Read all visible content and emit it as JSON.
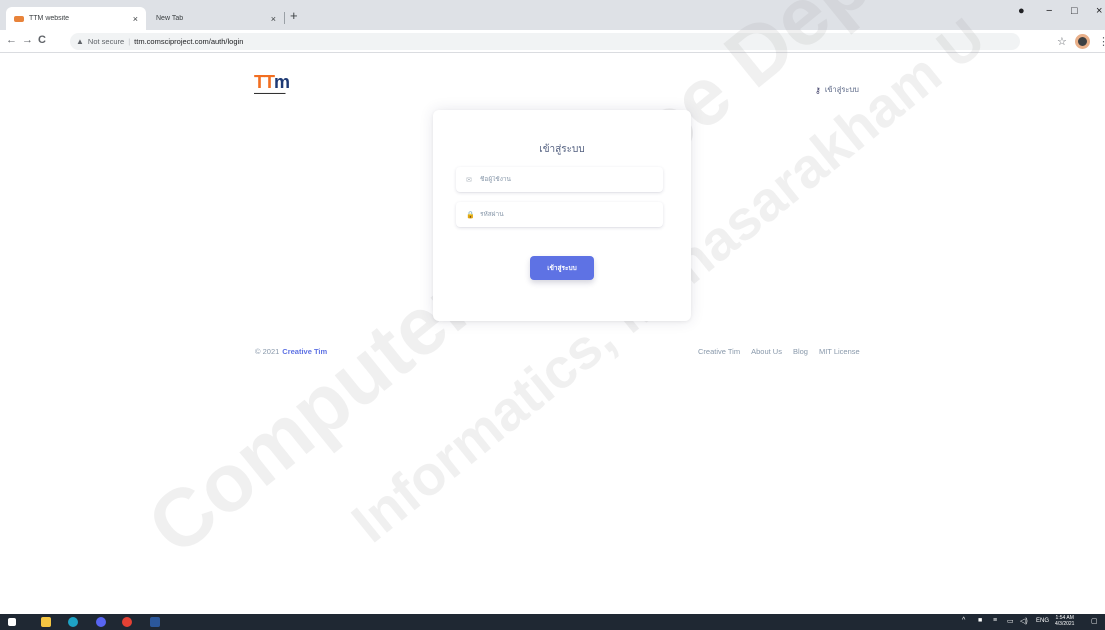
{
  "browser": {
    "tabs": [
      {
        "title": "TTM website",
        "close": "×"
      },
      {
        "title": "New Tab",
        "close": "×"
      }
    ],
    "new_tab": "+",
    "nav": {
      "back": "←",
      "forward": "→",
      "reload": "C"
    },
    "security_label": "Not secure",
    "url": "ttm.comsciproject.com/auth/login",
    "star": "☆",
    "menu": "⋮",
    "window": {
      "minimize": "−",
      "maximize": "□",
      "close": "×"
    }
  },
  "header": {
    "logo": {
      "letters_orange": "TT",
      "letters_blue": "m"
    },
    "login_link": "เข้าสู่ระบบ"
  },
  "login": {
    "title": "เข้าสู่ระบบ",
    "username_placeholder": "ชื่อผู้ใช้งาน",
    "password_placeholder": "รหัสผ่าน",
    "submit": "เข้าสู่ระบบ"
  },
  "footer": {
    "copyright": "© 2021",
    "brand": "Creative Tim",
    "links": [
      "Creative Tim",
      "About Us",
      "Blog",
      "MIT License"
    ]
  },
  "watermark": {
    "line1": "Computer Science Department",
    "line2": "Informatics, Mahasarakham U"
  },
  "taskbar": {
    "tray_lang": "ENG",
    "time": "1:54 AM",
    "date": "4/3/2021"
  },
  "colors": {
    "primary": "#5e72e4",
    "logo_orange": "#f26f21",
    "logo_blue": "#1e3a74",
    "taskbar": "#1f2833"
  }
}
